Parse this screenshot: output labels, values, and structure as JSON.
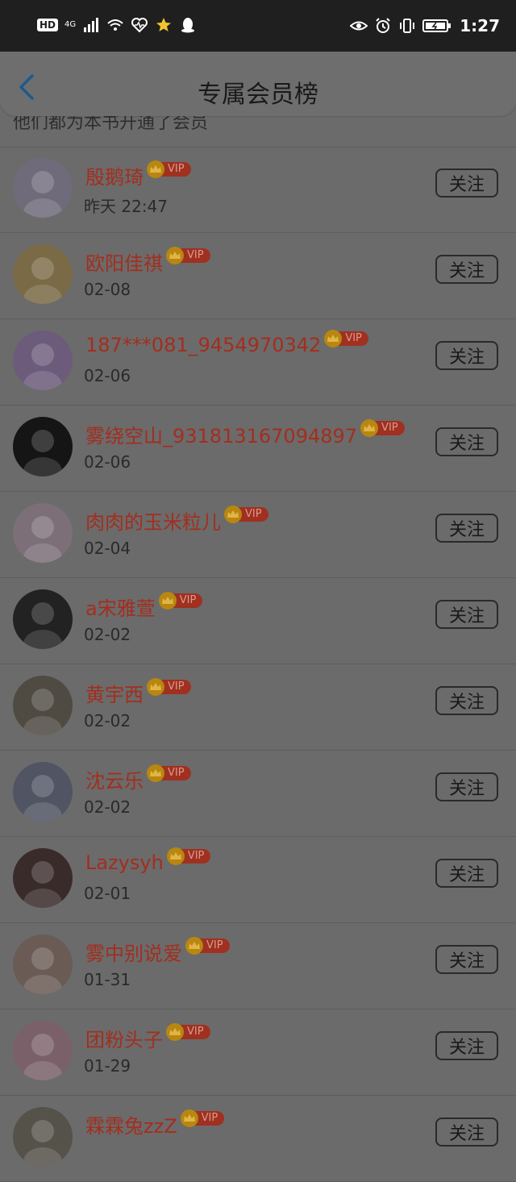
{
  "status_bar": {
    "hd": "HD",
    "network": "4G",
    "time": "1:27",
    "icons": [
      "signal-icon",
      "wifi-icon",
      "heart-monitor-icon",
      "star-icon",
      "qq-penguin-icon",
      "eye-icon",
      "alarm-icon",
      "vibrate-icon",
      "battery-charging-icon"
    ]
  },
  "header": {
    "title": "专属会员榜",
    "back_icon": "chevron-left-icon"
  },
  "subtitle": "他们都为本书开通了会员",
  "vip_label": "VIP",
  "follow_label": "关注",
  "members": [
    {
      "name": "殷鹅琦",
      "date": "昨天 22:47",
      "avatar_color": "#6f6b7a"
    },
    {
      "name": "欧阳佳祺",
      "date": "02-08",
      "avatar_color": "#7a6a45"
    },
    {
      "name": "187***081_9454970342",
      "date": "02-06",
      "avatar_color": "#6c5b7b"
    },
    {
      "name": "雾绕空山_931813167094897",
      "date": "02-06",
      "avatar_color": "#151515"
    },
    {
      "name": "肉肉的玉米粒儿",
      "date": "02-04",
      "avatar_color": "#7d6f78"
    },
    {
      "name": "a宋雅萱",
      "date": "02-02",
      "avatar_color": "#222222"
    },
    {
      "name": "黄宇西",
      "date": "02-02",
      "avatar_color": "#4f4a42"
    },
    {
      "name": "沈云乐",
      "date": "02-02",
      "avatar_color": "#505463"
    },
    {
      "name": "Lazysyh",
      "date": "02-01",
      "avatar_color": "#3a2b2b"
    },
    {
      "name": "雾中别说爱",
      "date": "01-31",
      "avatar_color": "#6a5b55"
    },
    {
      "name": "团粉头子",
      "date": "01-29",
      "avatar_color": "#7a6169"
    },
    {
      "name": "霖霖兔zzZ",
      "date": "",
      "avatar_color": "#55524a"
    }
  ]
}
